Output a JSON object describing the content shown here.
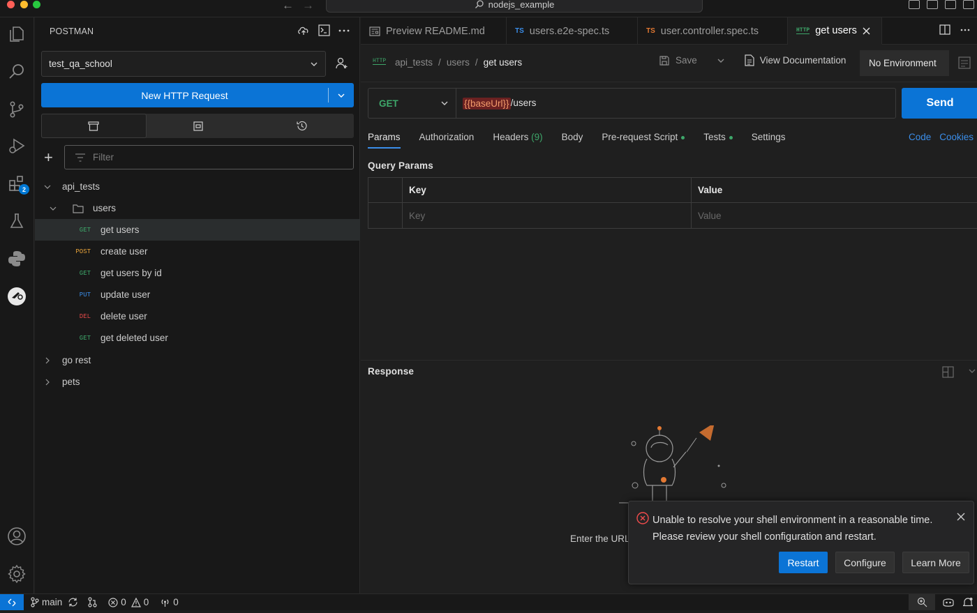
{
  "window": {
    "title": "nodejs_example"
  },
  "sidebar": {
    "title": "POSTMAN",
    "workspace": "test_qa_school",
    "new_request_label": "New HTTP Request",
    "filter_placeholder": "Filter",
    "tree": {
      "collection": "api_tests",
      "folder": "users",
      "requests": [
        {
          "method": "GET",
          "name": "get users",
          "color": "#3ea76a"
        },
        {
          "method": "POST",
          "name": "create user",
          "color": "#e8a33a"
        },
        {
          "method": "GET",
          "name": "get users by id",
          "color": "#3ea76a"
        },
        {
          "method": "PUT",
          "name": "update user",
          "color": "#3b8eea"
        },
        {
          "method": "DEL",
          "name": "delete user",
          "color": "#e04848"
        },
        {
          "method": "GET",
          "name": "get deleted user",
          "color": "#3ea76a"
        }
      ],
      "other_collections": [
        "go rest",
        "pets"
      ]
    }
  },
  "tabs": [
    {
      "label": "Preview README.md",
      "kind": "preview"
    },
    {
      "label": "users.e2e-spec.ts",
      "kind": "TS"
    },
    {
      "label": "user.controller.spec.ts",
      "kind": "TS"
    },
    {
      "label": "get users",
      "kind": "HTTP"
    }
  ],
  "request": {
    "badge": "HTTP",
    "breadcrumb": [
      "api_tests",
      "users",
      "get users"
    ],
    "breadcrumb_sep": "/",
    "save_label": "Save",
    "view_docs_label": "View Documentation",
    "environment": "No Environment",
    "method": "GET",
    "url_variable": "{{baseUrl}}",
    "url_path": "/users",
    "send_label": "Send",
    "tabs": {
      "params": "Params",
      "authorization": "Authorization",
      "headers": "Headers",
      "headers_count": "(9)",
      "body": "Body",
      "prerequest": "Pre-request Script",
      "tests": "Tests",
      "settings": "Settings"
    },
    "code_link": "Code",
    "cookies_link": "Cookies",
    "query_params": {
      "title": "Query Params",
      "key_header": "Key",
      "value_header": "Value",
      "key_placeholder": "Key",
      "value_placeholder": "Value"
    }
  },
  "response": {
    "title": "Response",
    "hint": "Enter the URL"
  },
  "notification": {
    "line1": "Unable to resolve your shell environment in a reasonable time.",
    "line2": "Please review your shell configuration and restart.",
    "buttons": [
      "Restart",
      "Configure",
      "Learn More"
    ]
  },
  "statusbar": {
    "branch": "main",
    "errors": "0",
    "warnings": "0",
    "ports": "0"
  },
  "colors": {
    "accent": "#0b74d6",
    "get": "#3ea76a",
    "post": "#e8a33a",
    "put": "#3b8eea",
    "delete": "#e04848"
  }
}
